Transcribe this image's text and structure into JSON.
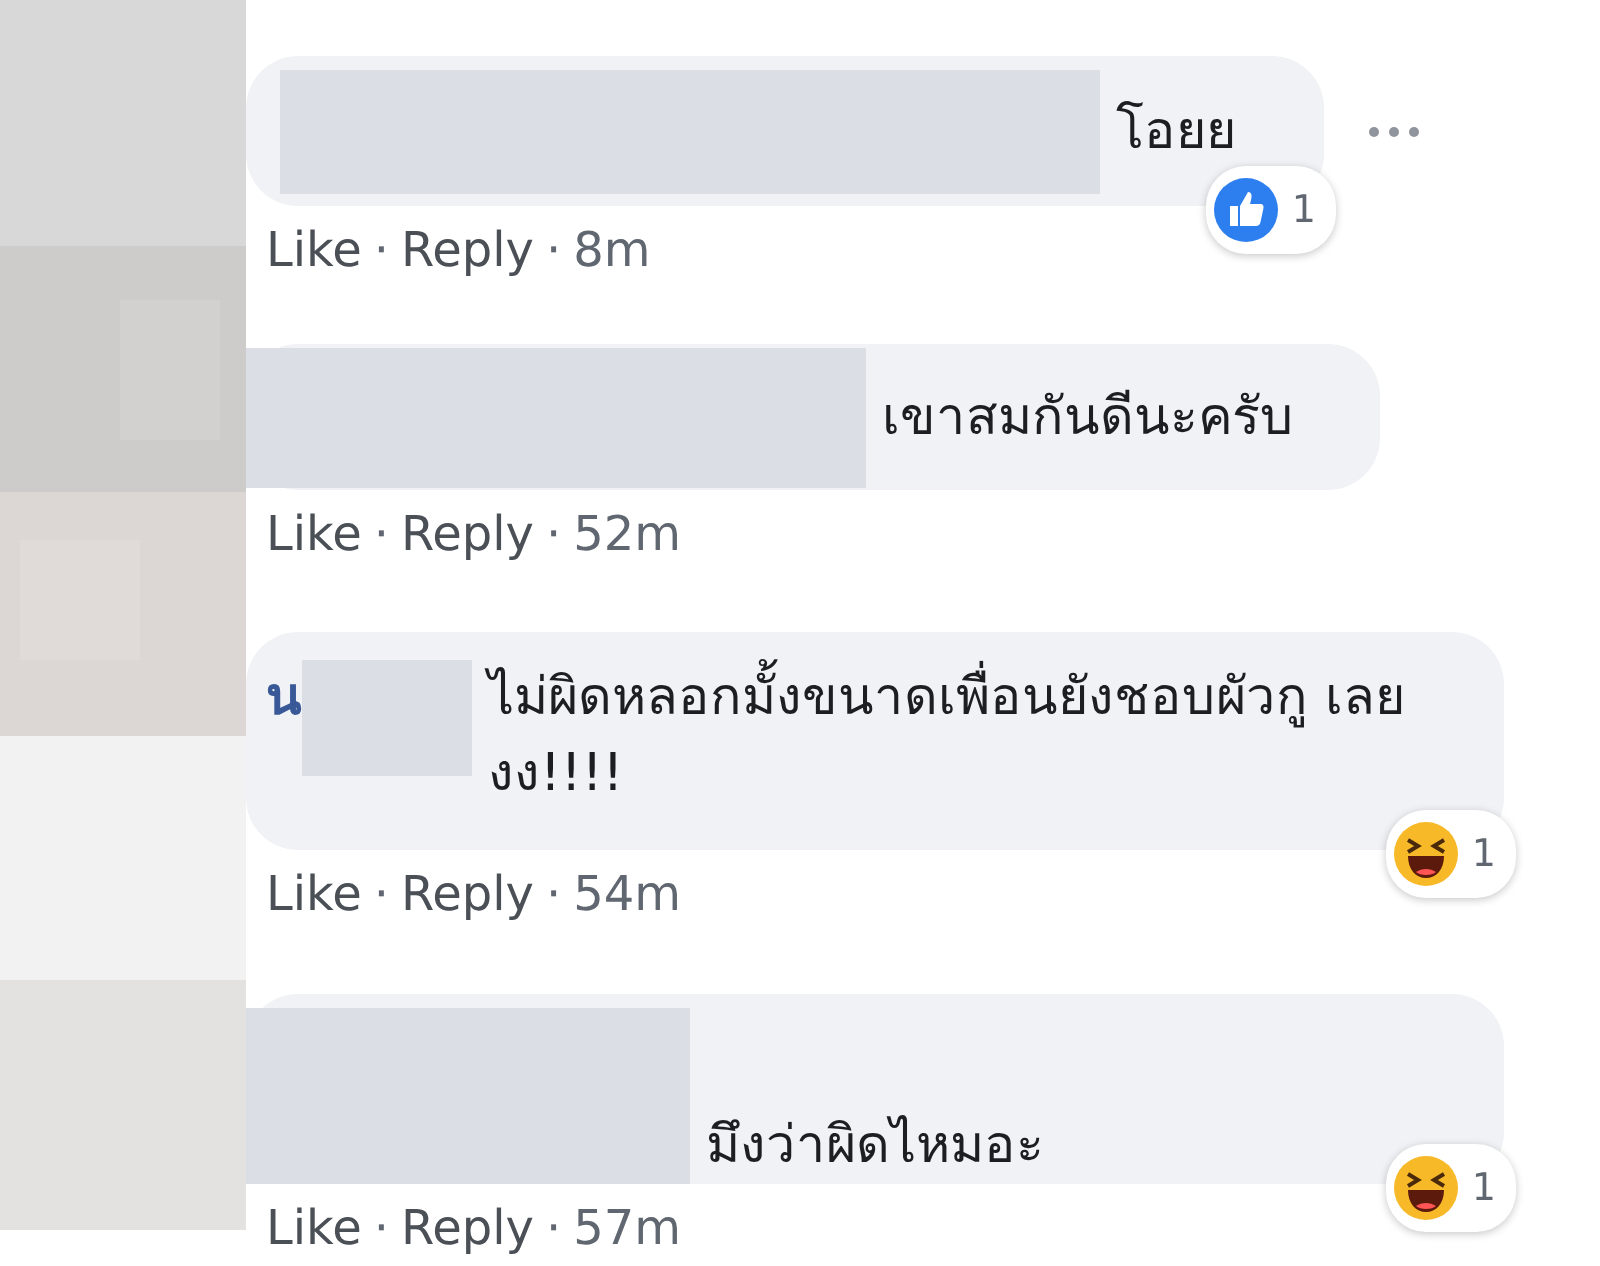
{
  "comments": [
    {
      "redacted": true,
      "text": "โอยย",
      "actions": {
        "like": "Like",
        "dot": "·",
        "reply": "Reply",
        "dot2": "·",
        "time": "8m"
      },
      "reaction": {
        "kind": "like",
        "count": "1"
      },
      "more_menu": true
    },
    {
      "redacted": true,
      "text": "เขาสมกันดีนะครับ",
      "actions": {
        "like": "Like",
        "dot": "·",
        "reply": "Reply",
        "dot2": "·",
        "time": "52m"
      },
      "more_menu": false
    },
    {
      "redacted": true,
      "name_fragment": "น",
      "text": "ไม่ผิดหลอกมั้งขนาดเพื่อนยังชอบผัวกู เลยงง!!!!",
      "actions": {
        "like": "Like",
        "dot": "·",
        "reply": "Reply",
        "dot2": "·",
        "time": "54m"
      },
      "reaction": {
        "kind": "haha",
        "count": "1"
      },
      "more_menu": false
    },
    {
      "redacted": true,
      "text": "มึงว่าผิดไหมอะ",
      "actions": {
        "like": "Like",
        "dot": "·",
        "reply": "Reply",
        "dot2": "·",
        "time": "57m"
      },
      "reaction": {
        "kind": "haha",
        "count": "1"
      },
      "more_menu": false
    }
  ]
}
